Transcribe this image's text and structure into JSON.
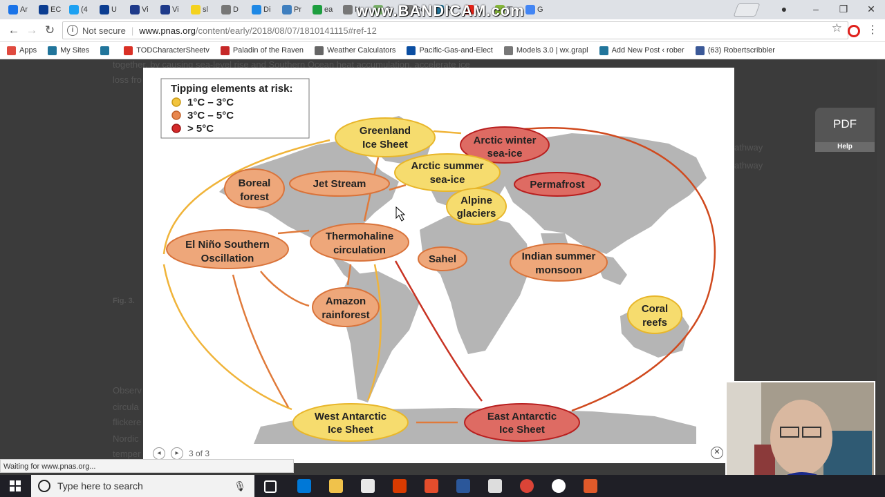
{
  "browser": {
    "tabs": [
      {
        "label": "Ar",
        "color": "#1a73e8"
      },
      {
        "label": "EC",
        "color": "#0b3d91"
      },
      {
        "label": "(4",
        "color": "#1da1f2"
      },
      {
        "label": "U",
        "color": "#0b3d91"
      },
      {
        "label": "Vi",
        "color": "#1e3a8a"
      },
      {
        "label": "Vi",
        "color": "#1e3a8a"
      },
      {
        "label": "sl",
        "color": "#f4d21f"
      },
      {
        "label": "D",
        "color": "#777777"
      },
      {
        "label": "Di",
        "color": "#1e88e5"
      },
      {
        "label": "Pr",
        "color": "#3f7fbf"
      },
      {
        "label": "ea",
        "color": "#1d9e3f"
      },
      {
        "label": "N",
        "color": "#777777"
      },
      {
        "label": "G",
        "color": "#7bb36a"
      },
      {
        "label": "Sc",
        "color": "#777777"
      },
      {
        "label": "Ri",
        "color": "#21759b"
      },
      {
        "label": "(4",
        "color": "#e62117"
      },
      {
        "label": "Ti",
        "color": "#86b83a"
      },
      {
        "label": "G",
        "color": "#4285f4"
      }
    ],
    "watermark": "www.BANDICAM.com",
    "security_label": "Not secure",
    "url_host": "www.pnas.org",
    "url_path": "/content/early/2018/08/07/1810141115#ref-12",
    "bookmarks": [
      {
        "label": "Apps",
        "color": "#e04a3f"
      },
      {
        "label": "My Sites",
        "color": "#21759b"
      },
      {
        "label": "",
        "color": "#21759b"
      },
      {
        "label": "TODCharacterSheetv",
        "color": "#d93025"
      },
      {
        "label": "Paladin of the Raven",
        "color": "#c62828"
      },
      {
        "label": "Weather Calculators",
        "color": "#666666"
      },
      {
        "label": "Pacific-Gas-and-Elect",
        "color": "#0b4ea2"
      },
      {
        "label": "Models 3.0 | wx.grapl",
        "color": "#777777"
      },
      {
        "label": "Add New Post ‹ rober",
        "color": "#21759b"
      },
      {
        "label": "(63) Robertscribbler",
        "color": "#3b5998"
      }
    ]
  },
  "page": {
    "bg_text_top": "together, by causing sea-level rise and Southern Ocean heat accumulation, accelerate ice",
    "bg_text_top2": "loss fro",
    "fig_label": "Fig. 3.",
    "side_text_1": "athway",
    "side_text_2": "athway",
    "bottom_text": "Observ",
    "bottom_text2": "circula",
    "bottom_text3": "flickere",
    "bottom_text4": "Nordic",
    "bottom_text5": "temper"
  },
  "figure": {
    "legend": {
      "title": "Tipping elements at risk:",
      "items": [
        {
          "label": "1°C – 3°C",
          "color": "#f2c43d"
        },
        {
          "label": "3°C – 5°C",
          "color": "#e8874e"
        },
        {
          "label": "> 5°C",
          "color": "#d42a2a"
        }
      ]
    },
    "elements": [
      {
        "id": "greenland",
        "line1": "Greenland",
        "line2": "Ice Sheet",
        "risk": "low"
      },
      {
        "id": "arctic-winter",
        "line1": "Arctic winter",
        "line2": "sea-ice",
        "risk": "high"
      },
      {
        "id": "arctic-summer",
        "line1": "Arctic summer",
        "line2": "sea-ice",
        "risk": "low"
      },
      {
        "id": "boreal",
        "line1": "Boreal",
        "line2": "forest",
        "risk": "mid"
      },
      {
        "id": "jetstream",
        "line1": "Jet Stream",
        "line2": "",
        "risk": "mid"
      },
      {
        "id": "permafrost",
        "line1": "Permafrost",
        "line2": "",
        "risk": "high"
      },
      {
        "id": "alpine",
        "line1": "Alpine",
        "line2": "glaciers",
        "risk": "low"
      },
      {
        "id": "enso",
        "line1": "El Niño Southern",
        "line2": "Oscillation",
        "risk": "mid"
      },
      {
        "id": "thermohaline",
        "line1": "Thermohaline",
        "line2": "circulation",
        "risk": "mid"
      },
      {
        "id": "sahel",
        "line1": "Sahel",
        "line2": "",
        "risk": "mid"
      },
      {
        "id": "indian",
        "line1": "Indian summer",
        "line2": "monsoon",
        "risk": "mid"
      },
      {
        "id": "amazon",
        "line1": "Amazon",
        "line2": "rainforest",
        "risk": "mid"
      },
      {
        "id": "coral",
        "line1": "Coral",
        "line2": "reefs",
        "risk": "low"
      },
      {
        "id": "wais",
        "line1": "West Antarctic",
        "line2": "Ice Sheet",
        "risk": "low"
      },
      {
        "id": "eais",
        "line1": "East Antarctic",
        "line2": "Ice Sheet",
        "risk": "high"
      }
    ],
    "pager_text": "3 of 3"
  },
  "pdf_widget": {
    "label": "PDF",
    "help": "Help"
  },
  "status_text": "Waiting for www.pnas.org...",
  "taskbar": {
    "search_placeholder": "Type here to search"
  }
}
